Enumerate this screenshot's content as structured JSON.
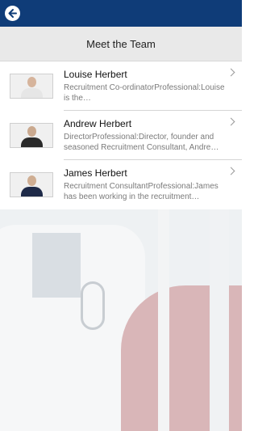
{
  "header": {
    "back_icon": "back-arrow-icon",
    "bar_color": "#0f3c78"
  },
  "page": {
    "title": "Meet the Team"
  },
  "team": [
    {
      "name": "Louise Herbert",
      "description": "Recruitment Co-ordinatorProfessional:Louise is the…",
      "avatar_colors": {
        "head": "#d6b49c",
        "body": "#e6e6e6"
      }
    },
    {
      "name": "Andrew Herbert",
      "description": "DirectorProfessional:Director, founder and seasoned Recruitment Consultant, Andre…",
      "avatar_colors": {
        "head": "#caa98f",
        "body": "#2a2a2a"
      }
    },
    {
      "name": "James Herbert",
      "description": "Recruitment ConsultantProfessional:James has been working in the recruitment…",
      "avatar_colors": {
        "head": "#cfae93",
        "body": "#1e2a48"
      }
    }
  ]
}
